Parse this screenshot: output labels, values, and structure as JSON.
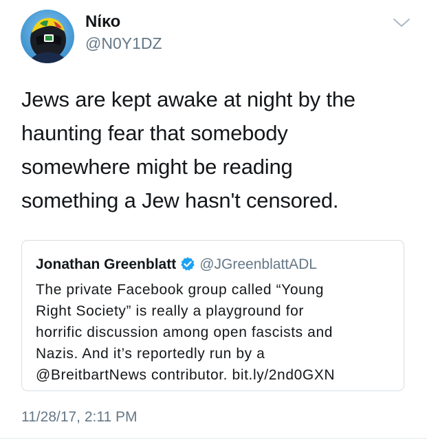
{
  "author": {
    "display_name": "Νίκο",
    "handle": "@N0Y1DZ",
    "avatar_icon": "helmet-avatar-icon"
  },
  "tweet": {
    "lines": [
      "Jews are kept awake at night by the",
      "haunting fear that somebody",
      "somewhere might be reading",
      "something a Jew hasn't censored."
    ],
    "timestamp": "11/28/17, 2:11 PM"
  },
  "quoted_tweet": {
    "display_name": "Jonathan Greenblatt",
    "handle": "@JGreenblattADL",
    "verified": true,
    "lines": [
      "The private Facebook group called “Young",
      "Right Society” is really a playground for",
      "horrific discussion among open fascists and",
      "Nazis. And it’s reportedly run by a",
      "@BreitbartNews contributor. bit.ly/2nd0GXN"
    ]
  },
  "colors": {
    "text_primary": "#14171a",
    "text_secondary": "#657786",
    "verified_blue": "#1da1f2",
    "card_border": "#d7dde2",
    "chevron": "#aab8c2"
  }
}
